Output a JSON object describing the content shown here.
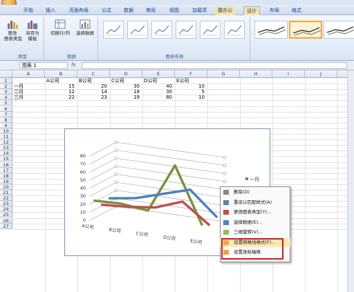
{
  "ribbon": {
    "tabs": [
      "开始",
      "插入",
      "页面布局",
      "公式",
      "数据",
      "审阅",
      "视图",
      "加载项",
      "整办公",
      "设计",
      "布局",
      "格式"
    ],
    "groups": {
      "type": {
        "label": "类型",
        "buttons": [
          {
            "line1": "更改",
            "line2": "图表类型"
          },
          {
            "line1": "另存为",
            "line2": "模板"
          }
        ]
      },
      "data": {
        "label": "数据",
        "buttons": [
          {
            "line1": "切换行/列"
          },
          {
            "line1": "选择数据"
          }
        ]
      },
      "layout": {
        "label": "图表布局"
      }
    }
  },
  "formula_bar": {
    "name_box": "图表 1",
    "fx": "fx"
  },
  "sheet": {
    "columns": [
      "A",
      "B",
      "C",
      "D",
      "E",
      "F",
      "G",
      "H",
      "I",
      "J",
      "K"
    ],
    "rows": [
      "1",
      "2",
      "3",
      "4",
      "5",
      "6",
      "7",
      "8",
      "9",
      "10",
      "11",
      "12",
      "13",
      "14",
      "15",
      "16",
      "17",
      "18",
      "19",
      "20",
      "21",
      "22",
      "23",
      "24",
      "25",
      "26",
      "27"
    ],
    "header_row": [
      "",
      "A公司",
      "B公司",
      "C公司",
      "D公司",
      "E公司"
    ],
    "data_rows": [
      {
        "label": "一月",
        "values": [
          "15",
          "20",
          "30",
          "40",
          "10"
        ]
      },
      {
        "label": "二月",
        "values": [
          "12",
          "14",
          "18",
          "30",
          "5"
        ]
      },
      {
        "label": "三月",
        "values": [
          "22",
          "23",
          "19",
          "80",
          "10"
        ]
      }
    ]
  },
  "chart_data": {
    "type": "line",
    "categories": [
      "A公司",
      "B公司",
      "C公司",
      "D公司",
      "E公司"
    ],
    "series": [
      {
        "name": "一月",
        "values": [
          15,
          20,
          30,
          40,
          10
        ],
        "color": "#4f81bd"
      },
      {
        "name": "二月",
        "values": [
          12,
          14,
          18,
          30,
          5
        ],
        "color": "#c0504d"
      },
      {
        "name": "三月",
        "values": [
          22,
          23,
          19,
          80,
          10
        ],
        "color": "#77933c"
      }
    ],
    "yticks": [
      "0",
      "10",
      "20",
      "30",
      "40",
      "50",
      "60",
      "70",
      "80"
    ],
    "ylim": [
      0,
      80
    ],
    "legend": "right",
    "legend_visible": [
      "一月"
    ]
  },
  "context_menu": {
    "items": [
      {
        "label": "删除(D)",
        "icon": "delete-icon"
      },
      {
        "label": "重设以匹配样式(A)",
        "icon": "reset-icon"
      },
      {
        "label": "更改图表类型(Y)...",
        "icon": "chart-type-icon"
      },
      {
        "label": "选择数据(E)...",
        "icon": "select-data-icon"
      },
      {
        "label": "三维旋转(V)...",
        "icon": "rotate-3d-icon"
      },
      {
        "label": "设置网格线格式(F)...",
        "icon": "gridline-icon"
      },
      {
        "label": "设置坐标轴格",
        "icon": "axis-icon"
      }
    ]
  },
  "colors": {
    "highlight": "#fde9b4",
    "annotation": "#d01818",
    "accent": "#15428b"
  }
}
